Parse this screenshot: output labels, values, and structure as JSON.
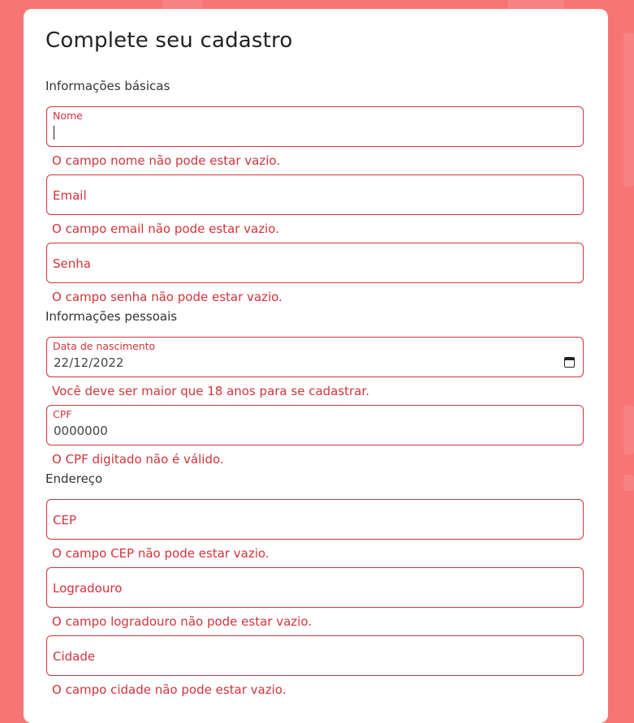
{
  "form": {
    "title": "Complete seu cadastro",
    "sections": {
      "basic": "Informações básicas",
      "personal": "Informações pessoais",
      "address": "Endereço"
    },
    "fields": {
      "nome": {
        "label": "Nome",
        "value": "",
        "error": "O campo nome não pode estar vazio."
      },
      "email": {
        "label": "Email",
        "value": "",
        "error": "O campo email não pode estar vazio."
      },
      "senha": {
        "label": "Senha",
        "value": "",
        "error": "O campo senha não pode estar vazio."
      },
      "nascimento": {
        "label": "Data de nascimento",
        "value": "22/12/2022",
        "error": "Você deve ser maior que 18 anos para se cadastrar."
      },
      "cpf": {
        "label": "CPF",
        "value": "0000000",
        "error": "O CPF digitado não é válido."
      },
      "cep": {
        "label": "CEP",
        "value": "",
        "error": "O campo CEP não pode estar vazio."
      },
      "logradouro": {
        "label": "Logradouro",
        "value": "",
        "error": "O campo logradouro não pode estar vazio."
      },
      "cidade": {
        "label": "Cidade",
        "value": "",
        "error": "O campo cidade não pode estar vazio."
      }
    }
  },
  "icons": {
    "date_picker": "calendar-icon"
  },
  "colors": {
    "background": "#f87575",
    "error": "#d3333b",
    "card": "#ffffff"
  }
}
